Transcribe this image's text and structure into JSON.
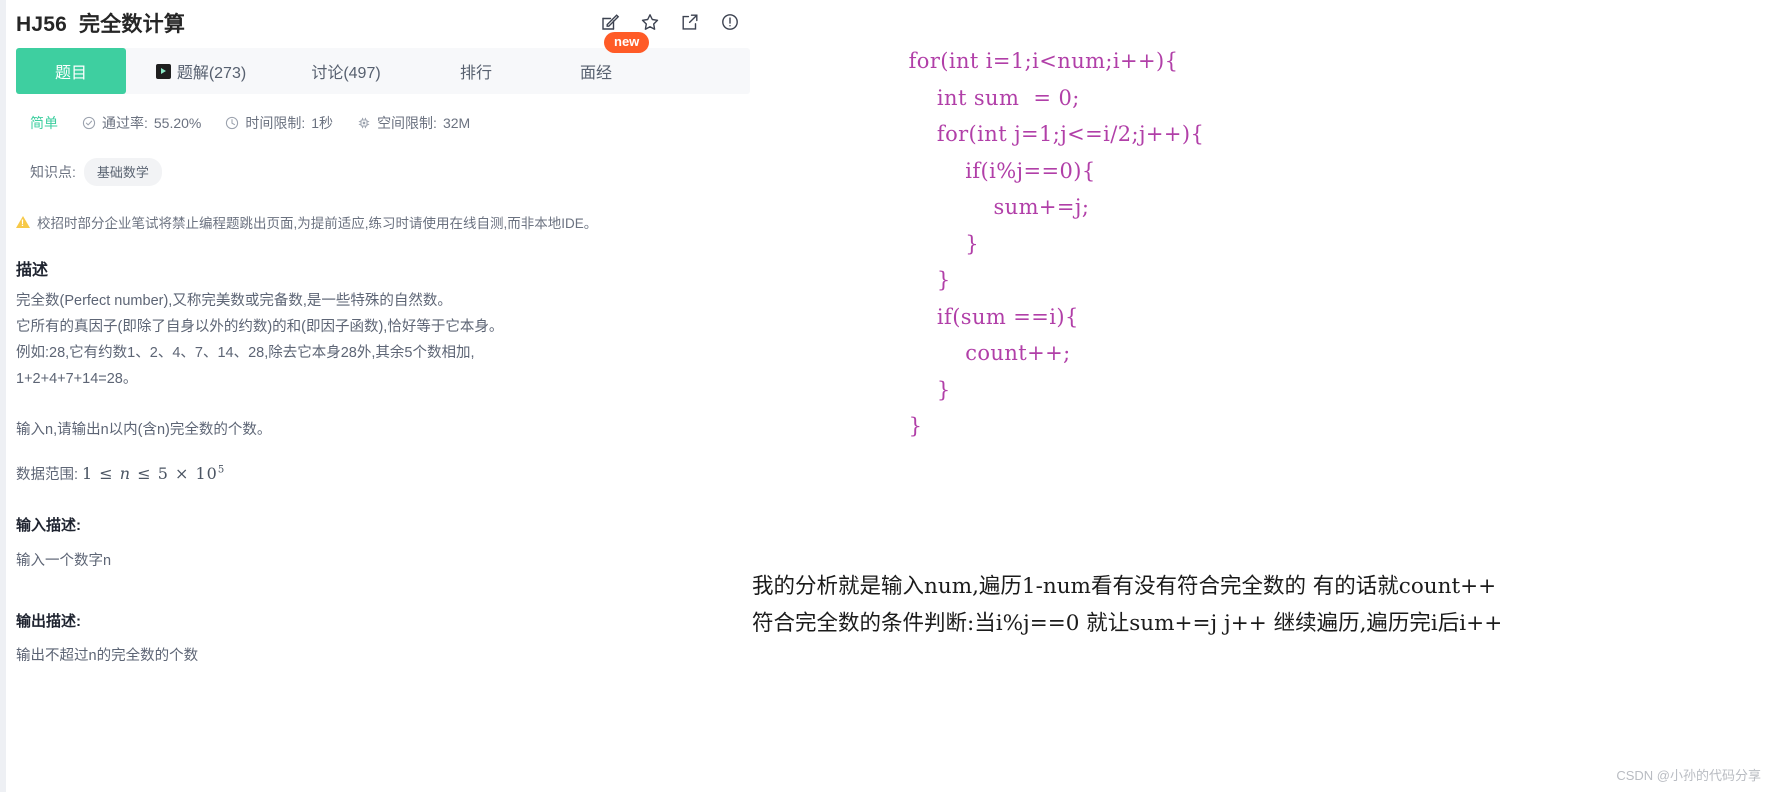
{
  "problem": {
    "id": "HJ56",
    "title": "完全数计算",
    "actions": [
      {
        "name": "edit-note-icon",
        "glyph": "edit"
      },
      {
        "name": "favorite-star-icon",
        "glyph": "star"
      },
      {
        "name": "share-external-icon",
        "glyph": "share"
      },
      {
        "name": "report-info-icon",
        "glyph": "info"
      }
    ],
    "new_badge": "new"
  },
  "tabs": [
    {
      "label": "题目",
      "active": true,
      "icon": null
    },
    {
      "label": "题解(273)",
      "active": false,
      "icon": "video-icon"
    },
    {
      "label": "讨论(497)",
      "active": false,
      "icon": null
    },
    {
      "label": "排行",
      "active": false,
      "icon": null
    },
    {
      "label": "面经",
      "active": false,
      "icon": null
    }
  ],
  "meta": {
    "difficulty": "简单",
    "items": [
      {
        "icon": "check-circle-icon",
        "label": "通过率:",
        "value": "55.20%"
      },
      {
        "icon": "clock-icon",
        "label": "时间限制:",
        "value": "1秒"
      },
      {
        "icon": "chip-icon",
        "label": "空间限制:",
        "value": "32M"
      }
    ]
  },
  "knowledge": {
    "label": "知识点:",
    "tags": [
      "基础数学"
    ]
  },
  "notice": {
    "icon": "warning-icon",
    "text": "校招时部分企业笔试将禁止编程题跳出页面,为提前适应,练习时请使用在线自测,而非本地IDE。"
  },
  "sections": {
    "description_heading": "描述",
    "description_body": "完全数(Perfect number),又称完美数或完备数,是一些特殊的自然数。\n它所有的真因子(即除了自身以外的约数)的和(即因子函数),恰好等于它本身。\n例如:28,它有约数1、2、4、7、14、28,除去它本身28外,其余5个数相加,\n1+2+4+7+14=28。",
    "description_body2": "输入n,请输出n以内(含n)完全数的个数。",
    "range_label": "数据范围:",
    "range_expr": "1 ≤ n ≤ 5 × 10",
    "range_exp": "5",
    "input_heading": "输入描述:",
    "input_body": "输入一个数字n",
    "output_heading": "输出描述:",
    "output_body": "输出不超过n的完全数的个数"
  },
  "code": {
    "language": "java",
    "text": "        for(int i=1;i<num;i++){\n            int sum  = 0;\n            for(int j=1;j<=i/2;j++){\n                if(i%j==0){\n                    sum+=j;\n                }\n            }\n            if(sum ==i){\n                count++;\n            }\n        }"
  },
  "analysis": {
    "text": "我的分析就是输入num,遍历1-num看有没有符合完全数的 有的话就count++\n符合完全数的条件判断:当i%j==0 就让sum+=j j++ 继续遍历,遍历完i后i++"
  },
  "watermark": "CSDN @小孙的代码分享",
  "colors": {
    "accent_green": "#3ecfa0",
    "badge_orange": "#ff5b27",
    "code_purple": "#b13fa8",
    "text_gray": "#5d6575"
  }
}
